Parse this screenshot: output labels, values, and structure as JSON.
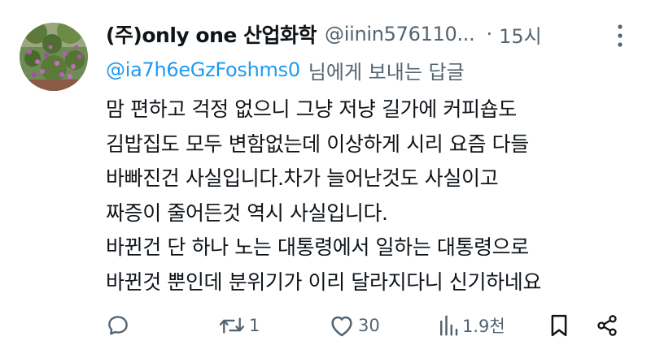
{
  "tweet": {
    "display_name": "(주)only one 산업화학",
    "handle": "@iinin576110...",
    "separator": "·",
    "timestamp": "15시",
    "reply_to": {
      "mention": "@ia7h6eGzFoshms0",
      "suffix": "님에게 보내는 답글"
    },
    "body_lines": [
      "맘 편하고 걱정 없으니 그냥 저냥 길가에 커피숍도",
      "김밥집도 모두 변함없는데 이상하게 시리 요즘 다들",
      "바빠진건 사실입니다.차가 늘어난것도 사실이고",
      "짜증이 줄어든것 역시 사실입니다.",
      "바뀐건 단 하나 노는 대통령에서 일하는 대통령으로",
      "바뀐것 뿐인데 분위기가 이리 달라지다니 신기하네요"
    ],
    "actions": {
      "reply_icon": "speech-bubble-icon",
      "retweet_icon": "retweet-icon",
      "retweet_count": "1",
      "like_icon": "heart-icon",
      "like_count": "30",
      "views_icon": "bar-chart-icon",
      "views_count": "1.9천",
      "bookmark_icon": "bookmark-icon",
      "share_icon": "share-icon"
    },
    "more_icon": "more-vertical-icon",
    "colors": {
      "text": "#0f1419",
      "secondary": "#536471",
      "mention": "#1d9bf0"
    }
  }
}
